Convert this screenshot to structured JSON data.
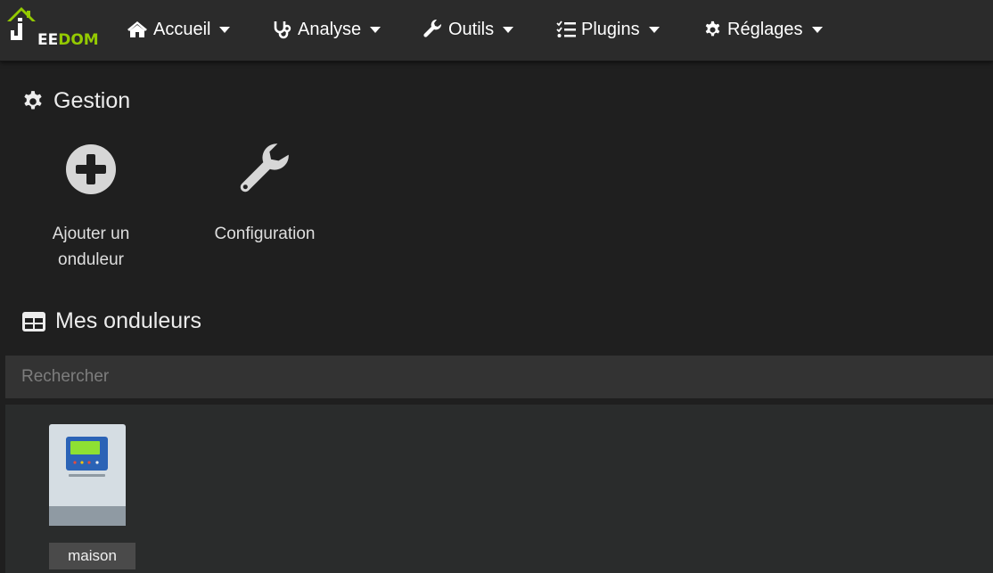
{
  "app": {
    "logo_text_left": "EE",
    "logo_text_right": "DOM",
    "brand_color": "#94ca02"
  },
  "nav": [
    {
      "label": "Accueil",
      "icon": "home-icon"
    },
    {
      "label": "Analyse",
      "icon": "stethoscope-icon"
    },
    {
      "label": "Outils",
      "icon": "wrench-icon"
    },
    {
      "label": "Plugins",
      "icon": "tasks-icon"
    },
    {
      "label": "Réglages",
      "icon": "gear-icon"
    }
  ],
  "gestion": {
    "title": "Gestion",
    "actions": [
      {
        "label": "Ajouter un onduleur",
        "icon": "plus-circle-icon"
      },
      {
        "label": "Configuration",
        "icon": "wrench-icon"
      }
    ]
  },
  "equipments": {
    "title": "Mes onduleurs",
    "search_placeholder": "Rechercher",
    "items": [
      {
        "name": "maison",
        "icon": "inverter-icon"
      }
    ]
  }
}
